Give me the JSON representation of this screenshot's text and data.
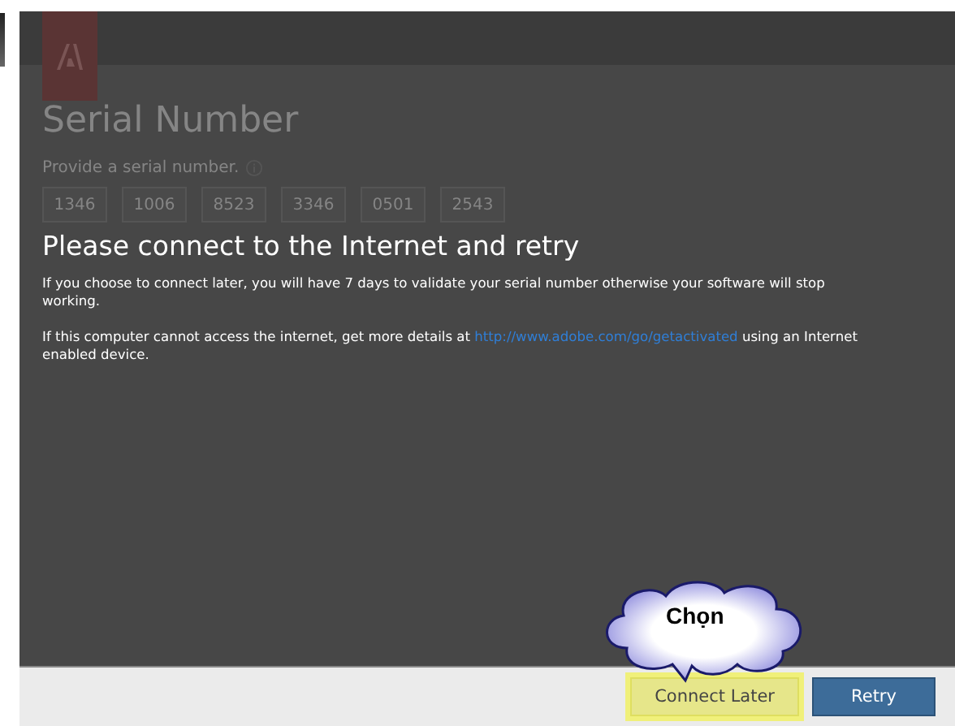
{
  "dialog": {
    "background_form": {
      "title": "Serial Number",
      "prompt": "Provide a serial number.",
      "serial_fields": [
        "1346",
        "1006",
        "8523",
        "3346",
        "0501",
        "2543"
      ]
    },
    "message": {
      "heading": "Please connect to the Internet and retry",
      "paragraph_1": "If you choose to connect later, you will have 7 days to validate your serial number otherwise your software will stop working.",
      "paragraph_2": {
        "text_before": "If this computer cannot access the internet, get more details at",
        "link": "http://www.adobe.com/go/getactivated",
        "text_after": "using an Internet enabled device."
      }
    },
    "buttons": [
      {
        "label": "Connect Later",
        "kind": "secondary",
        "highlighted": true
      },
      {
        "label": "Retry",
        "kind": "primary",
        "highlighted": false
      }
    ]
  },
  "callout": {
    "text": "Chọn"
  }
}
